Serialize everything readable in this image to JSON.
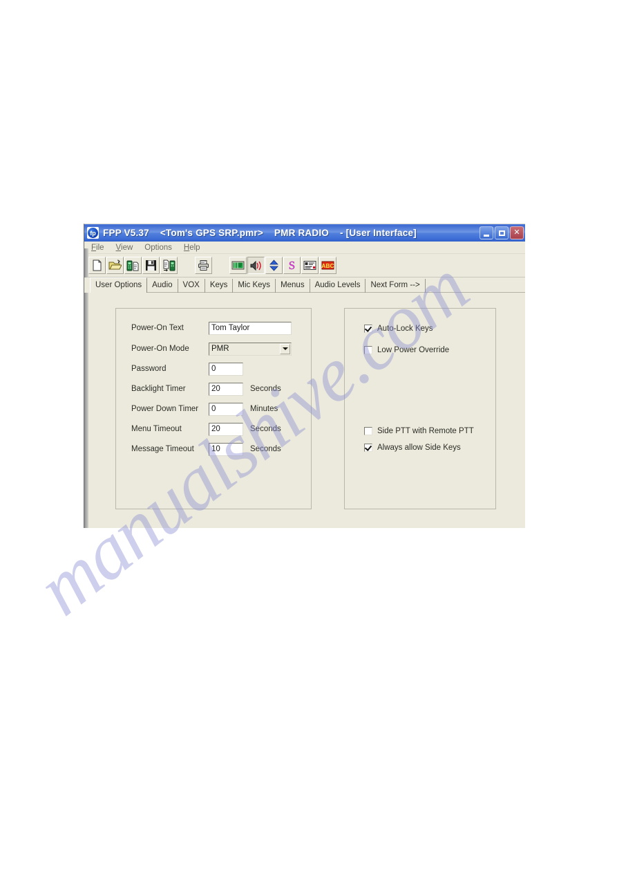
{
  "window": {
    "app_name": "FPP V5.37",
    "document": "<Tom's GPS SRP.pmr>",
    "radio": "PMR RADIO",
    "child_window": "- [User Interface]",
    "app_icon": "radio-app-icon",
    "icon_text": "fp",
    "controls": {
      "minimize": "minimize-button",
      "maximize": "maximize-button",
      "close_label": "✕"
    }
  },
  "menu": {
    "items": [
      {
        "label": "File",
        "accel": "F"
      },
      {
        "label": "View",
        "accel": "V"
      },
      {
        "label": "Options",
        "accel": "O"
      },
      {
        "label": "Help",
        "accel": "H"
      }
    ]
  },
  "toolbar": {
    "group_file": [
      {
        "name": "new-file-button",
        "icon": "new-document-icon"
      },
      {
        "name": "open-file-button",
        "icon": "open-folder-icon"
      },
      {
        "name": "read-from-radio-button",
        "icon": "radio-to-file-icon"
      },
      {
        "name": "save-file-button",
        "icon": "floppy-save-icon"
      },
      {
        "name": "write-to-radio-button",
        "icon": "file-to-radio-icon"
      }
    ],
    "group_print": [
      {
        "name": "print-button",
        "icon": "printer-icon"
      }
    ],
    "group_forms": [
      {
        "name": "display-button",
        "icon": "lcd-display-icon",
        "pressed": false
      },
      {
        "name": "audio-button",
        "icon": "speaker-icon",
        "pressed": true
      },
      {
        "name": "updown-button",
        "icon": "up-down-arrow-icon",
        "pressed": false
      },
      {
        "name": "signalling-button",
        "icon": "letter-s-icon",
        "pressed": false
      },
      {
        "name": "text-list-button",
        "icon": "text-list-icon",
        "pressed": false
      },
      {
        "name": "abc-button",
        "icon": "abc-icon",
        "pressed": false
      }
    ],
    "abc_label": "ABC",
    "s_label": "S"
  },
  "tabs": [
    {
      "label": "User Options",
      "active": true
    },
    {
      "label": "Audio",
      "active": false
    },
    {
      "label": "VOX",
      "active": false
    },
    {
      "label": "Keys",
      "active": false
    },
    {
      "label": "Mic Keys",
      "active": false
    },
    {
      "label": "Menus",
      "active": false
    },
    {
      "label": "Audio Levels",
      "active": false
    },
    {
      "label": "Next Form -->",
      "active": false
    }
  ],
  "form": {
    "left_panel": {
      "rows": [
        {
          "label": "Power-On Text",
          "type": "text",
          "value": "Tom Taylor",
          "unit": ""
        },
        {
          "label": "Power-On Mode",
          "type": "combo",
          "value": "PMR",
          "unit": ""
        },
        {
          "label": "Password",
          "type": "number",
          "value": "0",
          "unit": ""
        },
        {
          "label": "Backlight Timer",
          "type": "number",
          "value": "20",
          "unit": "Seconds"
        },
        {
          "label": "Power Down Timer",
          "type": "number",
          "value": "0",
          "unit": "Minutes"
        },
        {
          "label": "Menu Timeout",
          "type": "number",
          "value": "20",
          "unit": "Seconds"
        },
        {
          "label": "Message Timeout",
          "type": "number",
          "value": "10",
          "unit": "Seconds"
        }
      ]
    },
    "right_panel": {
      "group_top": [
        {
          "label": "Auto-Lock Keys",
          "checked": true
        },
        {
          "label": "Low Power Override",
          "checked": false
        }
      ],
      "group_bottom": [
        {
          "label": "Side PTT with Remote PTT",
          "checked": false
        },
        {
          "label": "Always allow Side Keys",
          "checked": true
        }
      ]
    }
  },
  "watermark": {
    "text": "manualshive.com",
    "color": "#8b8fd4"
  }
}
